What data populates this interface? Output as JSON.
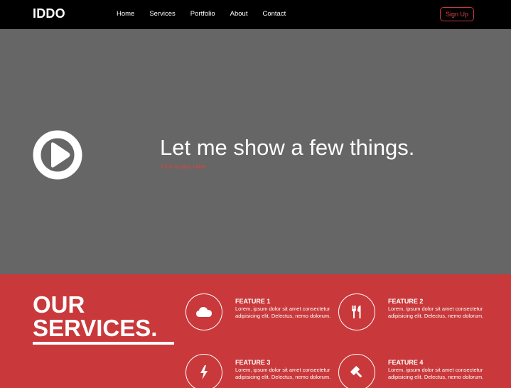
{
  "navbar": {
    "brand": "IDDO",
    "links": [
      "Home",
      "Services",
      "Portfolio",
      "About",
      "Contact"
    ],
    "signup_label": "Sign Up"
  },
  "hero": {
    "play_icon": "play-circle-icon",
    "title": "Let me show a few things.",
    "link_text": "Click to play video"
  },
  "services": {
    "heading_line1": "OUR",
    "heading_line2": "SERVICES.",
    "features": [
      {
        "title": "FEATURE 1",
        "icon": "cloud-icon",
        "text": "Lorem, ipsum dolor sit amet consectetur adipisicing elit. Delectus, nemo dolorum."
      },
      {
        "title": "FEATURE 2",
        "icon": "utensils-icon",
        "text": "Lorem, ipsum dolor sit amet consectetur adipisicing elit. Delectus, nemo dolorum."
      },
      {
        "title": "FEATURE 3",
        "icon": "bolt-icon",
        "text": "Lorem, ipsum dolor sit amet consectetur adipisicing elit. Delectus, nemo dolorum."
      },
      {
        "title": "FEATURE 4",
        "icon": "gavel-icon",
        "text": "Lorem, ipsum dolor sit amet consectetur adipisicing elit. Delectus, nemo dolorum."
      }
    ]
  },
  "colors": {
    "navbar_bg": "#000000",
    "hero_bg": "#666666",
    "accent": "#c9393b",
    "text": "#ffffff"
  }
}
